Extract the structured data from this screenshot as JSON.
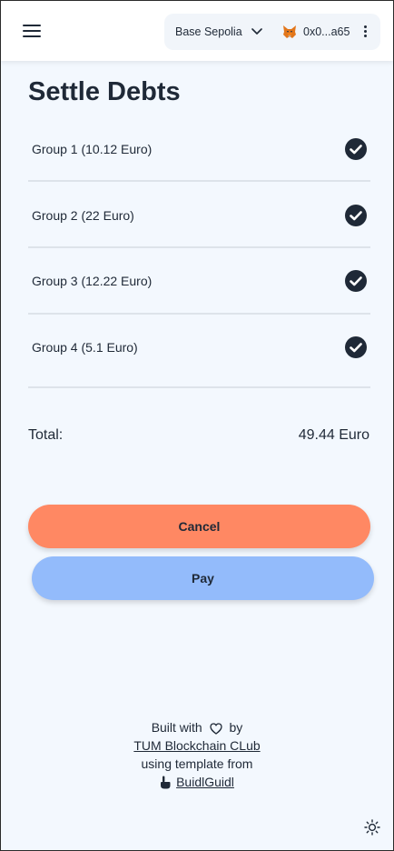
{
  "header": {
    "network": "Base Sepolia",
    "account": "0x0...a65"
  },
  "page": {
    "title": "Settle Debts"
  },
  "groups": [
    {
      "label": "Group 1 (10.12 Euro)",
      "checked": true
    },
    {
      "label": "Group 2 (22 Euro)",
      "checked": true
    },
    {
      "label": "Group 3 (12.22 Euro)",
      "checked": true
    },
    {
      "label": "Group 4 (5.1 Euro)",
      "checked": true
    }
  ],
  "total": {
    "label": "Total:",
    "value": "49.44 Euro"
  },
  "buttons": {
    "cancel": "Cancel",
    "pay": "Pay"
  },
  "footer": {
    "built_with": "Built with",
    "by": "by",
    "club_link": "TUM Blockchain CLub",
    "template_text": "using template from",
    "buidl_link": "BuidlGuidl"
  },
  "colors": {
    "cancel": "#ff8863",
    "pay": "#93bbfb",
    "background": "#f3f8fe",
    "text": "#1f2937"
  }
}
